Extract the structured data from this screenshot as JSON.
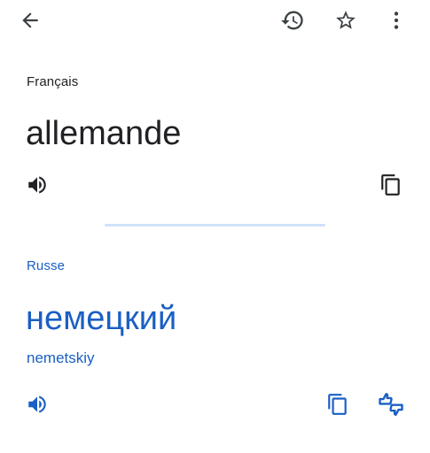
{
  "source": {
    "language": "Français",
    "text": "allemande"
  },
  "target": {
    "language": "Russe",
    "text": "немецкий",
    "transliteration": "nemetskiy"
  },
  "icons": {
    "top_bar": [
      "arrow-back-icon",
      "history-icon",
      "star-icon",
      "more-vert-icon"
    ],
    "source_actions": [
      "speaker-icon",
      "copy-icon"
    ],
    "target_actions": [
      "speaker-icon",
      "copy-icon",
      "thumbs-feedback-icon"
    ]
  },
  "colors": {
    "primary_text": "#202124",
    "accent_blue": "#1a5fc4",
    "divider": "#cfe3f7"
  }
}
